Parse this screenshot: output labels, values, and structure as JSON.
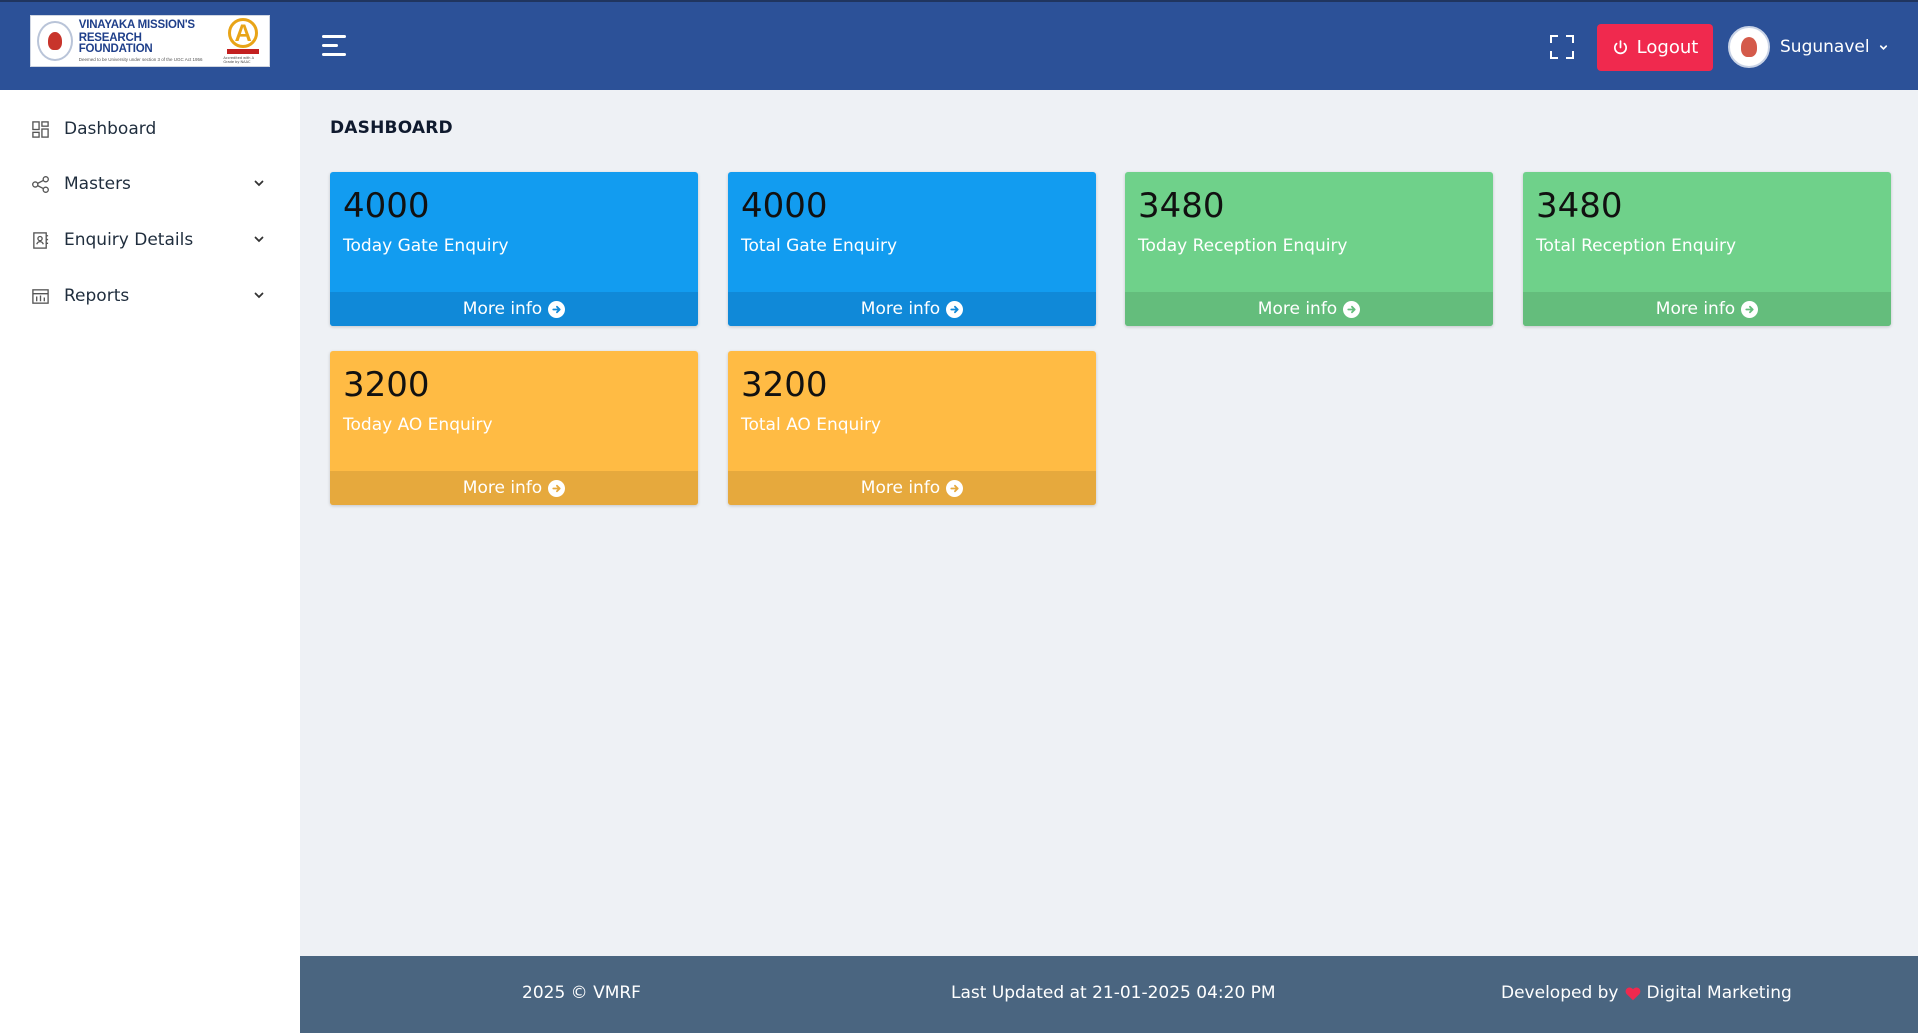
{
  "header": {
    "logo": {
      "line1": "VINAYAKA MISSION'S",
      "line2": "RESEARCH FOUNDATION",
      "line3": "Deemed to be University under section 3 of the UGC Act 1956",
      "badge_letter": "A",
      "badge_text": "Accredited with A Grade by NAAC"
    },
    "menu_icon": "hamburger-icon",
    "fullscreen_icon": "fullscreen-icon",
    "logout_label": "Logout",
    "logout_icon": "power-icon",
    "user_name": "Sugunavel",
    "logout_color": "#f0294e",
    "brand_color": "#2c5198"
  },
  "sidebar": {
    "items": [
      {
        "label": "Dashboard",
        "icon": "dashboard-icon",
        "expandable": false
      },
      {
        "label": "Masters",
        "icon": "share-icon",
        "expandable": true
      },
      {
        "label": "Enquiry Details",
        "icon": "contact-book-icon",
        "expandable": true
      },
      {
        "label": "Reports",
        "icon": "reports-icon",
        "expandable": true
      }
    ]
  },
  "main": {
    "title": "DASHBOARD",
    "cards": [
      {
        "value": "4000",
        "label": "Today Gate Enquiry",
        "link": "More info",
        "color": "#129cf0"
      },
      {
        "value": "4000",
        "label": "Total Gate Enquiry",
        "link": "More info",
        "color": "#129cf0"
      },
      {
        "value": "3480",
        "label": "Today Reception Enquiry",
        "link": "More info",
        "color": "#6fd18a"
      },
      {
        "value": "3480",
        "label": "Total Reception Enquiry",
        "link": "More info",
        "color": "#6fd18a"
      },
      {
        "value": "3200",
        "label": "Today AO Enquiry",
        "link": "More info",
        "color": "#ffbb44"
      },
      {
        "value": "3200",
        "label": "Total AO Enquiry",
        "link": "More info",
        "color": "#ffbb44"
      }
    ]
  },
  "footer": {
    "copyright": "2025 © VMRF",
    "last_updated": "Last Updated at 21-01-2025 04:20 PM",
    "developed_by": "Developed by",
    "developer": "Digital Marketing",
    "heart_color": "#f0294e"
  }
}
